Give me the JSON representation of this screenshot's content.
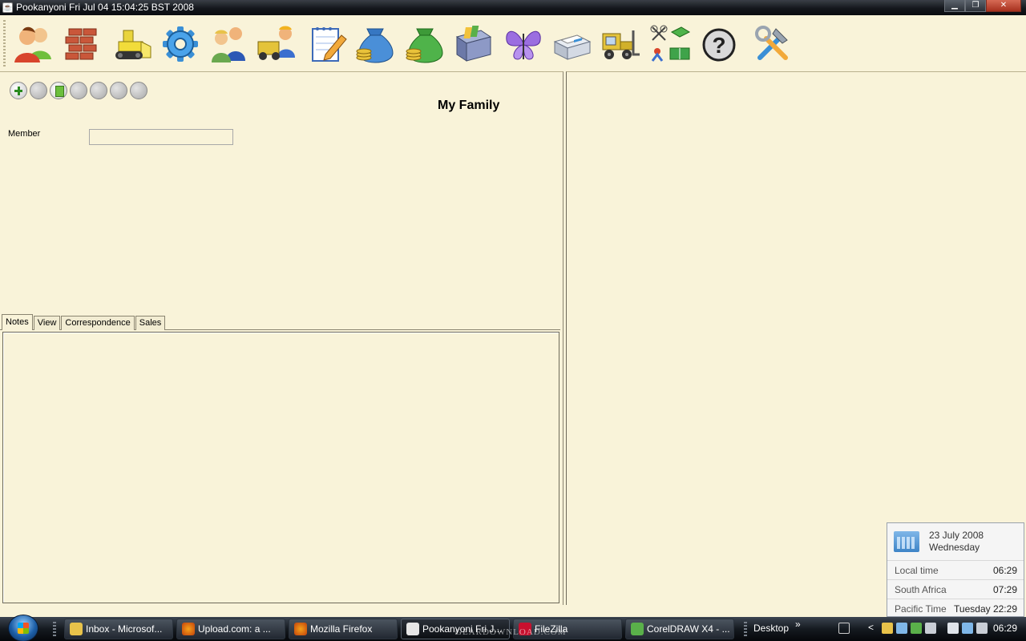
{
  "window": {
    "title": "Pookanyoni Fri Jul 04 15:04:25 BST 2008"
  },
  "toolbar": {
    "icons": [
      "members-icon",
      "brick-wall-icon",
      "bulldozer-icon",
      "gear-icon",
      "people-icon",
      "truck-worker-icon",
      "notepad-icon",
      "money-bag-blue-icon",
      "money-bag-green-icon",
      "filing-cabinet-icon",
      "butterfly-icon",
      "printer-icon",
      "forklift-icon",
      "sports-icon",
      "help-icon",
      "tools-icon"
    ]
  },
  "panel": {
    "title": "My Family",
    "member_label": "Member",
    "member_value": ""
  },
  "tabs": [
    "Notes",
    "View",
    "Correspondence",
    "Sales"
  ],
  "clock": {
    "date": "23 July 2008",
    "day": "Wednesday",
    "rows": [
      {
        "label": "Local time",
        "time": "06:29"
      },
      {
        "label": "South Africa",
        "time": "07:29"
      },
      {
        "label": "Pacific Time",
        "time": "Tuesday 22:29"
      }
    ]
  },
  "taskbar": {
    "tasks": [
      "Inbox - Microsof...",
      "Upload.com: a ...",
      "Mozilla Firefox",
      "Pookanyoni Fri J...",
      "FileZilla",
      "CorelDRAW X4 - ..."
    ],
    "desktop": "Desktop",
    "desktop_chevron": "»",
    "tray_chevron": "<",
    "time": "06:29",
    "watermark": "GEARDOWNLOAD.COM"
  }
}
